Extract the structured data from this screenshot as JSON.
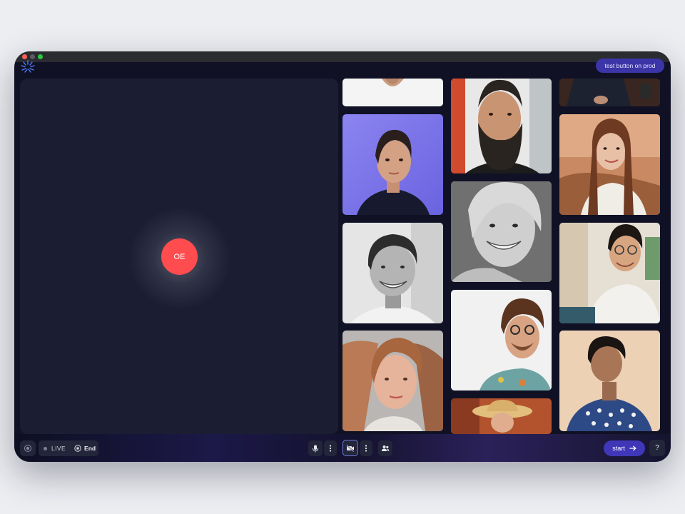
{
  "window": {
    "controls": [
      "close",
      "minimize",
      "zoom"
    ]
  },
  "header": {
    "logo_icon": "starburst-logo-icon",
    "test_button_label": "test button on prod"
  },
  "stage": {
    "avatar_initials": "OE",
    "avatar_color": "#ff4d4f"
  },
  "participants": [
    {
      "name": "participant-white-shirt",
      "kind": "photo"
    },
    {
      "name": "participant-bearded-man",
      "kind": "photo"
    },
    {
      "name": "participant-dark-jacket",
      "kind": "photo"
    },
    {
      "name": "participant-woman-blue-light",
      "kind": "photo"
    },
    {
      "name": "participant-smiling-woman-bw",
      "kind": "photo"
    },
    {
      "name": "participant-long-hair-woman",
      "kind": "photo"
    },
    {
      "name": "participant-smiling-man-bw",
      "kind": "photo"
    },
    {
      "name": "participant-curly-hair-man",
      "kind": "photo"
    },
    {
      "name": "participant-man-glasses-reading",
      "kind": "photo"
    },
    {
      "name": "participant-freckled-woman",
      "kind": "photo"
    },
    {
      "name": "participant-straw-hat",
      "kind": "photo"
    },
    {
      "name": "participant-looking-up",
      "kind": "photo"
    }
  ],
  "controls": {
    "record_icon": "record-icon",
    "live_label": "LIVE",
    "end_label": "End",
    "mic_icon": "microphone-icon",
    "camera_icon": "camera-off-icon",
    "more_icon": "more-vertical-icon",
    "people_icon": "people-icon",
    "start_label": "start",
    "help_label": "?",
    "accent_color": "#3f37b8"
  }
}
